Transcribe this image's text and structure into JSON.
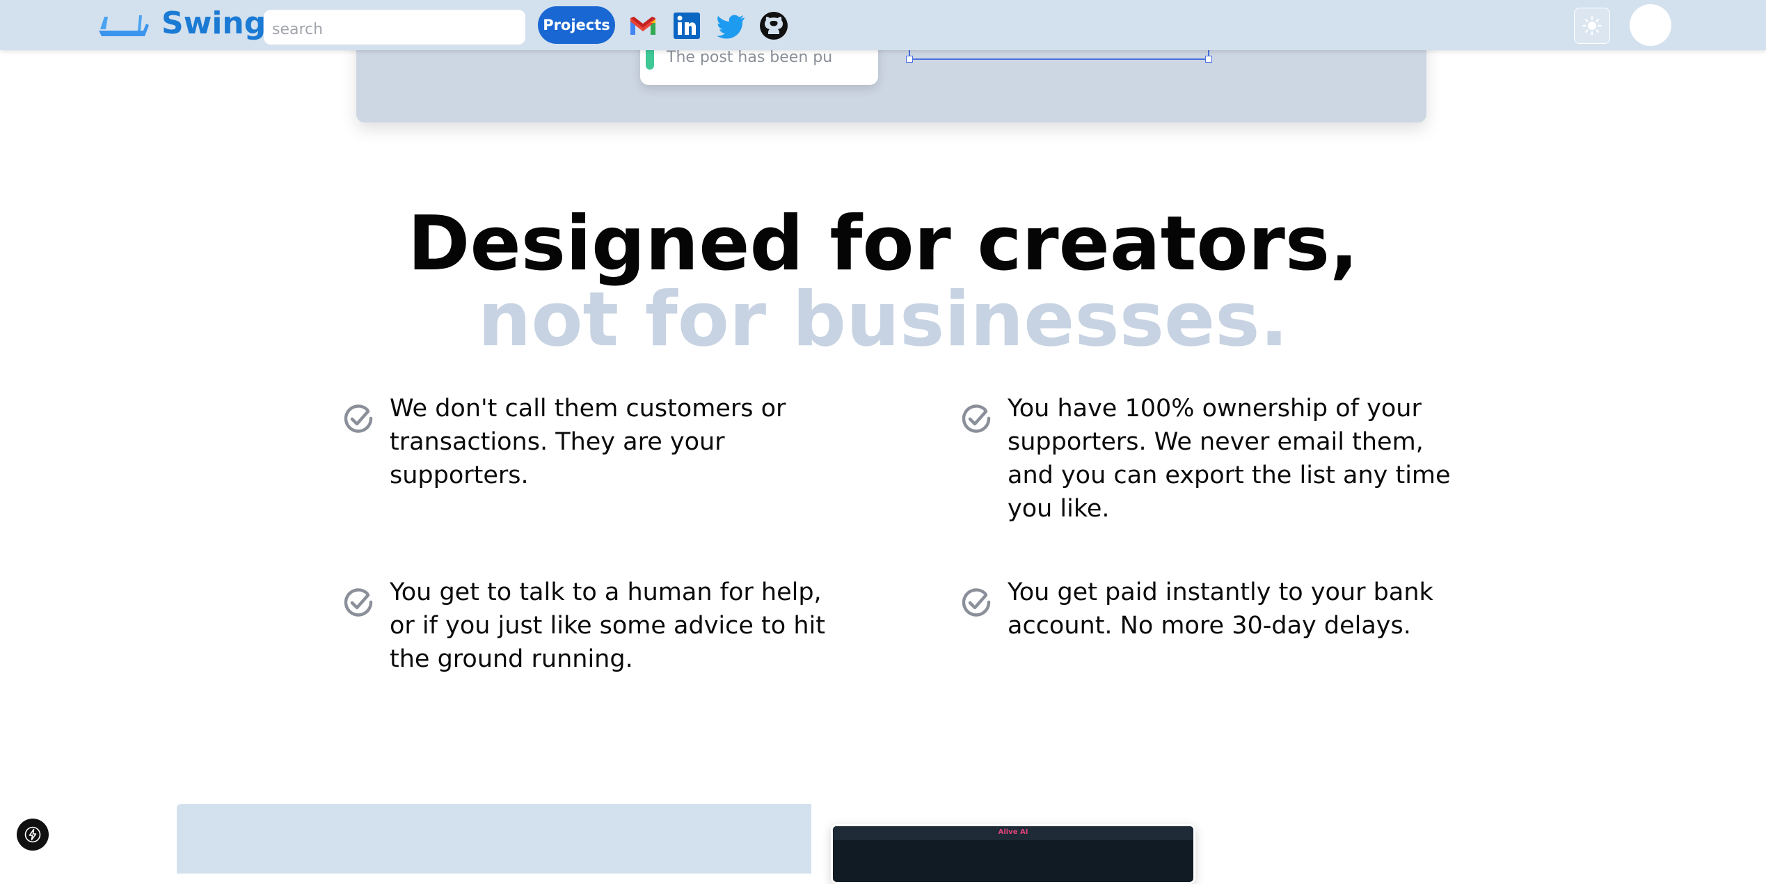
{
  "nav": {
    "brand": "Swing",
    "search_placeholder": "search",
    "projects_label": "Projects",
    "social_icons": [
      "gmail-icon",
      "linkedin-icon",
      "twitter-icon",
      "github-icon"
    ],
    "theme_icon": "sun-icon"
  },
  "preview": {
    "toast_text": "The post has been pu"
  },
  "headline": {
    "line1": "Designed for creators,",
    "line2": "not for businesses."
  },
  "features": [
    {
      "text": "We don't call them customers or transactions. They are your supporters."
    },
    {
      "text": "You have 100% ownership of your supporters. We never email them, and you can export the list any time you like."
    },
    {
      "text": "You get to talk to a human for help, or if you just like some advice to hit the ground running."
    },
    {
      "text": "You get paid instantly to your bank account. No more 30-day delays."
    }
  ],
  "bottom": {
    "app_title": "Alive AI"
  },
  "colors": {
    "brand": "#1a7ad4",
    "nav_bg": "#d3e0ee",
    "button": "#1967d2",
    "headline_muted": "#c7d3e2",
    "check": "#8a8f99"
  }
}
